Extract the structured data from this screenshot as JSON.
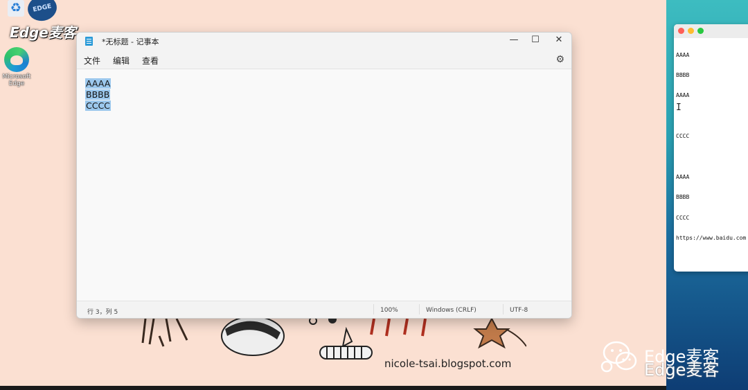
{
  "desktop": {
    "icons": [
      {
        "label": "",
        "icon": "recycle-bin-icon"
      },
      {
        "label": "Microsoft Edge",
        "icon": "edge-browser-icon"
      }
    ],
    "logo_text": "EDGE",
    "brand": "Edge麦客",
    "blog_url": "nicole-tsai.blogspot.com"
  },
  "notepad": {
    "title": "*无标题 - 记事本",
    "controls": {
      "minimize": "—",
      "maximize": "☐",
      "close": "✕"
    },
    "menu": {
      "file": "文件",
      "edit": "编辑",
      "view": "查看"
    },
    "settings_icon": "gear-icon",
    "lines": [
      "AAAA",
      "BBBB",
      "CCCC"
    ],
    "selection_color": "#9cc8ed",
    "status": {
      "position": "行 3，列 5",
      "zoom": "100%",
      "line_ending": "Windows (CRLF)",
      "encoding": "UTF-8"
    }
  },
  "mac_editor": {
    "lines": [
      "AAAA",
      "BBBB",
      "AAAA",
      "",
      "CCCC",
      "",
      "AAAA",
      "BBBB",
      "CCCC",
      "https://www.baidu.com"
    ]
  },
  "watermark": {
    "line1": "Edge麦客",
    "line2": "Edge麦客"
  }
}
